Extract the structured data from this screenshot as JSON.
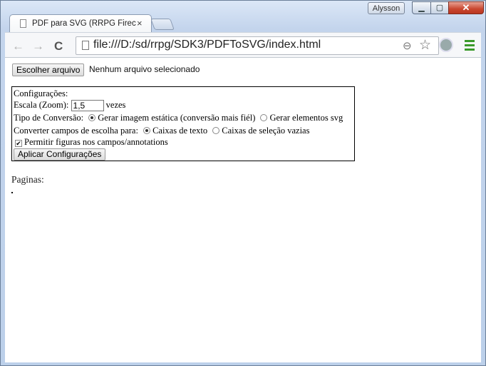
{
  "window": {
    "user_badge": "Alysson",
    "controls": {
      "minimize": "▁",
      "maximize": "▢",
      "close": "✕"
    }
  },
  "tab": {
    "title": "PDF para SVG (RRPG Firec",
    "close": "×"
  },
  "toolbar": {
    "back": "←",
    "forward": "→",
    "reload": "C",
    "url": "file:///D:/sd/rrpg/SDK3/PDFToSVG/index.html",
    "zoom_icon": "⊖",
    "star_icon": "☆"
  },
  "file": {
    "button_label": "Escolher arquivo",
    "status": "Nenhum arquivo selecionado"
  },
  "config": {
    "heading": "Configurações:",
    "scale_label": "Escala (Zoom):",
    "scale_value": "1,5",
    "scale_unit": "vezes",
    "conversion_label": "Tipo de Conversão:",
    "conversion_options": [
      "Gerar imagem estática (conversão mais fiél)",
      "Gerar elementos svg"
    ],
    "conversion_selected": 0,
    "fields_label": "Converter campos de escolha para:",
    "fields_options": [
      "Caixas de texto",
      "Caixas de seleção vazias"
    ],
    "fields_selected": 0,
    "allow_figures_label": "Permitir figuras nos campos/annotations",
    "allow_figures_checked": true,
    "apply_button": "Aplicar Configurações"
  },
  "pages": {
    "label": "Paginas:"
  }
}
